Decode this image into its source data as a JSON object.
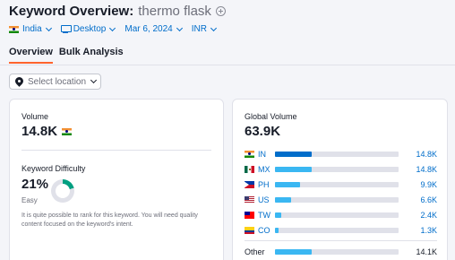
{
  "header": {
    "title": "Keyword Overview:",
    "keyword": "thermo flask"
  },
  "filters": {
    "country": "India",
    "device": "Desktop",
    "date": "Mar 6, 2024",
    "currency": "INR"
  },
  "tabs": [
    {
      "label": "Overview",
      "active": true
    },
    {
      "label": "Bulk Analysis",
      "active": false
    }
  ],
  "location_button": {
    "label": "Select location"
  },
  "volume": {
    "label": "Volume",
    "value": "14.8K"
  },
  "keyword_difficulty": {
    "label": "Keyword Difficulty",
    "value": "21%",
    "level": "Easy",
    "percent": 21,
    "color": "#009f81",
    "description": "It is quite possible to rank for this keyword. You will need quality content focused on the keyword's intent."
  },
  "global_volume": {
    "label": "Global Volume",
    "value": "63.9K",
    "rows": [
      {
        "code": "IN",
        "value": "14.8K",
        "share": 0.3,
        "color": "#006dca"
      },
      {
        "code": "MX",
        "value": "14.8K",
        "share": 0.3,
        "color": "#3ab7f2"
      },
      {
        "code": "PH",
        "value": "9.9K",
        "share": 0.2,
        "color": "#3ab7f2"
      },
      {
        "code": "US",
        "value": "6.6K",
        "share": 0.13,
        "color": "#3ab7f2"
      },
      {
        "code": "TW",
        "value": "2.4K",
        "share": 0.05,
        "color": "#3ab7f2"
      },
      {
        "code": "CO",
        "value": "1.3K",
        "share": 0.03,
        "color": "#3ab7f2"
      }
    ],
    "other": {
      "label": "Other",
      "value": "14.1K",
      "share": 0.3,
      "color": "#3ab7f2"
    }
  }
}
